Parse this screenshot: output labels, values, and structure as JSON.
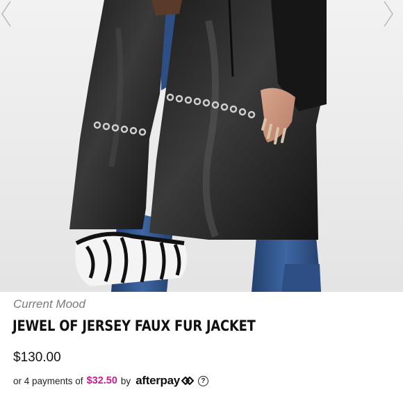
{
  "gallery": {
    "image_alt": "Model wearing black faux leather jacket with silver grommet details, blue jeans and zebra print bag",
    "prev_icon": "chevron-left-icon",
    "next_icon": "chevron-right-icon"
  },
  "product": {
    "brand": "Current Mood",
    "title": "JEWEL OF JERSEY FAUX FUR JACKET",
    "price": "$130.00"
  },
  "payment": {
    "prefix": "or 4 payments of",
    "amount": "$32.50",
    "by": "by",
    "provider": "afterpay",
    "provider_icon": "afterpay-arrows-icon",
    "help_icon": "question-circle-icon",
    "help_glyph": "?"
  },
  "colors": {
    "accent": "#c51d8f",
    "text": "#111111",
    "brand_text": "#7a7a7a"
  }
}
